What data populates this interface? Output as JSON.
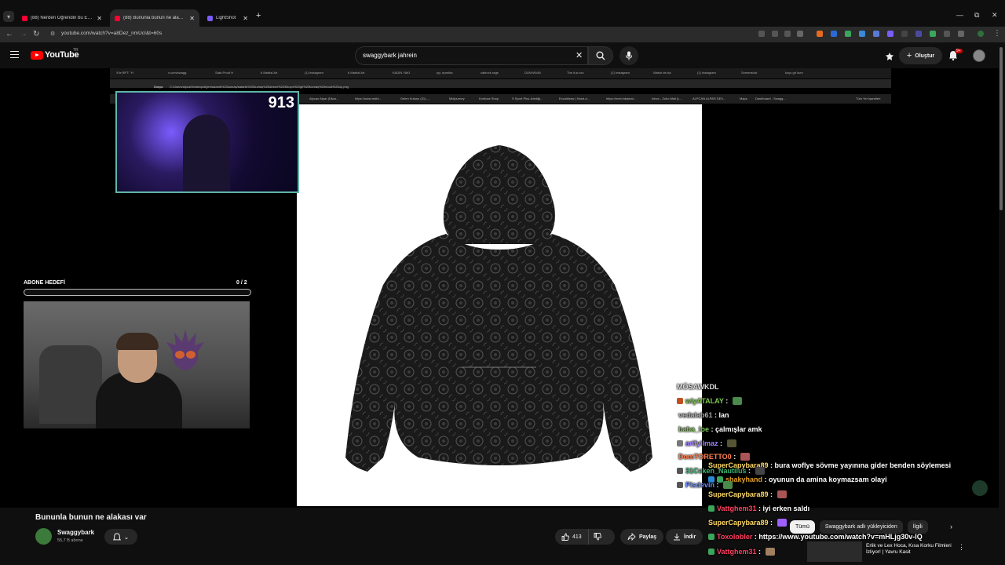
{
  "browser": {
    "tabs": [
      {
        "label": "(88) Nerden Öğrendin bu Edebi",
        "favicon_color": "#ff0033",
        "active": false
      },
      {
        "label": "(88) Bununla bunun ne alakası",
        "favicon_color": "#ff0033",
        "active": true
      },
      {
        "label": "LightShot",
        "favicon_color": "#7a5cff",
        "active": false
      }
    ],
    "url": "youtube.com/watch?v=a8Dez_nmUcI&t=60s"
  },
  "header": {
    "logo_text": "YouTube",
    "country_code": "TR",
    "search_value": "swaggybark jahrein",
    "create_label": "Oluştur",
    "notification_count": "9+"
  },
  "stream": {
    "inner_tabs": [
      "X'te BPT: \"H",
      "x.com/swagg",
      "Stab-Proof H",
      "6 Martial Art",
      "(1) Instagram",
      "6 Martial Art",
      "KADIN YAKI",
      "yçi, eparlha",
      "caltrock rage",
      "DÜNYANIN",
      "The it-st-rou",
      "(1) Instagram",
      "Watch de-ba",
      "(1) Instagram",
      "Screenshot",
      "koyu gri kum"
    ],
    "inner_url": "C:/Users/alpca/Desktop/diğer/satanik%20kumaş/satanik%20kumaş%20desen%203/koyu%20gri%20kumaş%20mock%20up.png",
    "inner_url_prefix": "Dosya",
    "bookmarks": [
      "Alpcan Alpar (Diwa...",
      "https://www.redbl...",
      "Gelen Kutusu (31) -...",
      "Midjourney",
      "Konfuse Shop",
      "S Sport Plus-İzlediği...",
      "Excalidraw | Hand-d...",
      "https://next.inkamat...",
      "Inbox - Zoho Mail (L...",
      "ALPCAN ALPAR DEV...",
      "Maps",
      "Dashboard - Swagg...",
      "Tüm Yer İşaretleri"
    ],
    "viewer_count": "913",
    "goal_label": "ABONE HEDEFİ",
    "goal_count": "0 / 2",
    "goal_progress": 0.0
  },
  "chat": [
    {
      "user": "MÖSAWKDL",
      "msg": "",
      "user_color": "#dddddd"
    },
    {
      "user": "wiyATALAY",
      "msg": "",
      "user_color": "#7ec850"
    },
    {
      "user": "vedalab61",
      "msg": "lan",
      "user_color": "#aaaaaa"
    },
    {
      "user": "baba_loe",
      "msg": "çalmışlar amk",
      "user_color": "#7ec850"
    },
    {
      "user": "arifyilmaz",
      "msg": "",
      "user_color": "#a080ff"
    },
    {
      "user": "DomTORETTO0",
      "msg": "",
      "user_color": "#ff7f50"
    },
    {
      "user": "SuperCapybara89",
      "msg": "bura woflye sövme yayınına gider benden söylemesi",
      "user_color": "#ffd966"
    },
    {
      "user": "31Ceken_Nautilus",
      "msg": "",
      "user_color": "#3cb371"
    },
    {
      "user": "shakyhand",
      "msg": "oyunun da amina koymazsam olayi",
      "user_color": "#e6a020"
    },
    {
      "user": "Plsdevin",
      "msg": "",
      "user_color": "#6a8cff"
    },
    {
      "user": "SuperCapybara89",
      "msg": "",
      "user_color": "#ffd966"
    },
    {
      "user": "Vattghem31",
      "msg": "iyi erken saldı",
      "user_color": "#ff4060"
    },
    {
      "user": "SuperCapybara89",
      "msg": "",
      "user_color": "#ffd966"
    },
    {
      "user": "Toxolobler",
      "msg": "https://www.youtube.com/watch?v=mHLjg30v-lQ",
      "user_color": "#ff4060"
    },
    {
      "user": "Vattghem31",
      "msg": "",
      "user_color": "#ff4060"
    }
  ],
  "recommendations": {
    "chips": [
      "Tümü",
      "Swaggybark adlı yükleyiciden",
      "İlgili"
    ],
    "first_title": "Erlik ve Lex Hoca, Kısa Korku Filmleri İzliyor! | Yavru Kasit"
  },
  "video": {
    "title": "Bununla bunun ne alakası var",
    "channel_name": "Swaggybark",
    "channel_subs": "55,7 B abone",
    "like_count": "413",
    "share_label": "Paylaş",
    "download_label": "İndir"
  }
}
